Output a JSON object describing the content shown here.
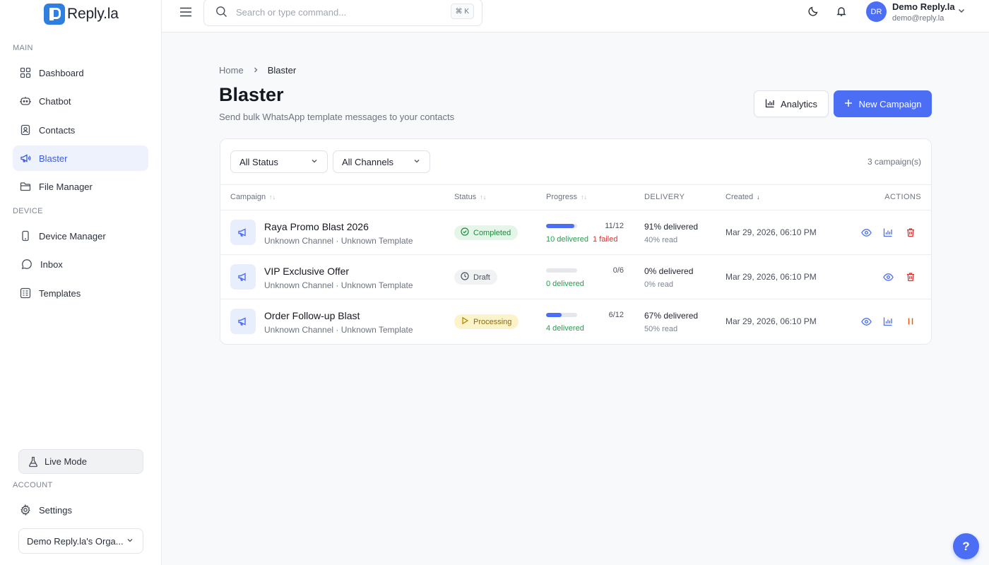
{
  "brand": {
    "name": "Reply.la"
  },
  "sidebar": {
    "sections": {
      "main": "MAIN",
      "device": "DEVICE",
      "account": "ACCOUNT"
    },
    "items": {
      "dashboard": "Dashboard",
      "chatbot": "Chatbot",
      "contacts": "Contacts",
      "blaster": "Blaster",
      "file_manager": "File Manager",
      "device_manager": "Device Manager",
      "inbox": "Inbox",
      "templates": "Templates",
      "settings": "Settings"
    },
    "active_item": "Blaster",
    "live_mode": "Live Mode",
    "organization": "Demo Reply.la's Orga..."
  },
  "topbar": {
    "search_placeholder": "Search or type command...",
    "shortcut": "⌘ K",
    "user": {
      "initials": "DR",
      "name": "Demo Reply.la",
      "email": "demo@reply.la"
    }
  },
  "breadcrumb": {
    "home": "Home",
    "current": "Blaster"
  },
  "page": {
    "title": "Blaster",
    "subtitle": "Send bulk WhatsApp template messages to your contacts",
    "analytics_label": "Analytics",
    "new_campaign_label": "New Campaign"
  },
  "filters": {
    "status": "All Status",
    "channels": "All Channels",
    "count_text": "3 campaign(s)"
  },
  "table": {
    "headers": {
      "campaign": "Campaign",
      "status": "Status",
      "progress": "Progress",
      "delivery": "DELIVERY",
      "created": "Created",
      "actions": "ACTIONS"
    },
    "rows": [
      {
        "name": "Raya Promo Blast 2026",
        "meta": "Unknown Channel · Unknown Template",
        "status": "Completed",
        "progress_count": "11/12",
        "progress_fraction": 0.92,
        "delivered_text": "10 delivered",
        "failed_text": "1 failed",
        "delivery": "91% delivered",
        "read": "40% read",
        "created": "Mar 29, 2026, 06:10 PM"
      },
      {
        "name": "VIP Exclusive Offer",
        "meta": "Unknown Channel · Unknown Template",
        "status": "Draft",
        "progress_count": "0/6",
        "progress_fraction": 0,
        "delivered_text": "0 delivered",
        "delivery": "0% delivered",
        "read": "0% read",
        "created": "Mar 29, 2026, 06:10 PM"
      },
      {
        "name": "Order Follow-up Blast",
        "meta": "Unknown Channel · Unknown Template",
        "status": "Processing",
        "progress_count": "6/12",
        "progress_fraction": 0.5,
        "delivered_text": "4 delivered",
        "delivery": "67% delivered",
        "read": "50% read",
        "created": "Mar 29, 2026, 06:10 PM"
      }
    ]
  },
  "help_label": "?",
  "colors": {
    "accent": "#4c6ef5",
    "success": "#22a04b",
    "danger": "#e03131",
    "warning": "#e8590c"
  },
  "icons": {
    "dashboard": "grid-icon",
    "chatbot": "bot-icon",
    "contacts": "contact-card-icon",
    "blaster": "megaphone-icon",
    "file_manager": "folder-icon",
    "device_manager": "smartphone-icon",
    "inbox": "message-circle-icon",
    "templates": "template-icon",
    "settings": "gear-icon"
  }
}
